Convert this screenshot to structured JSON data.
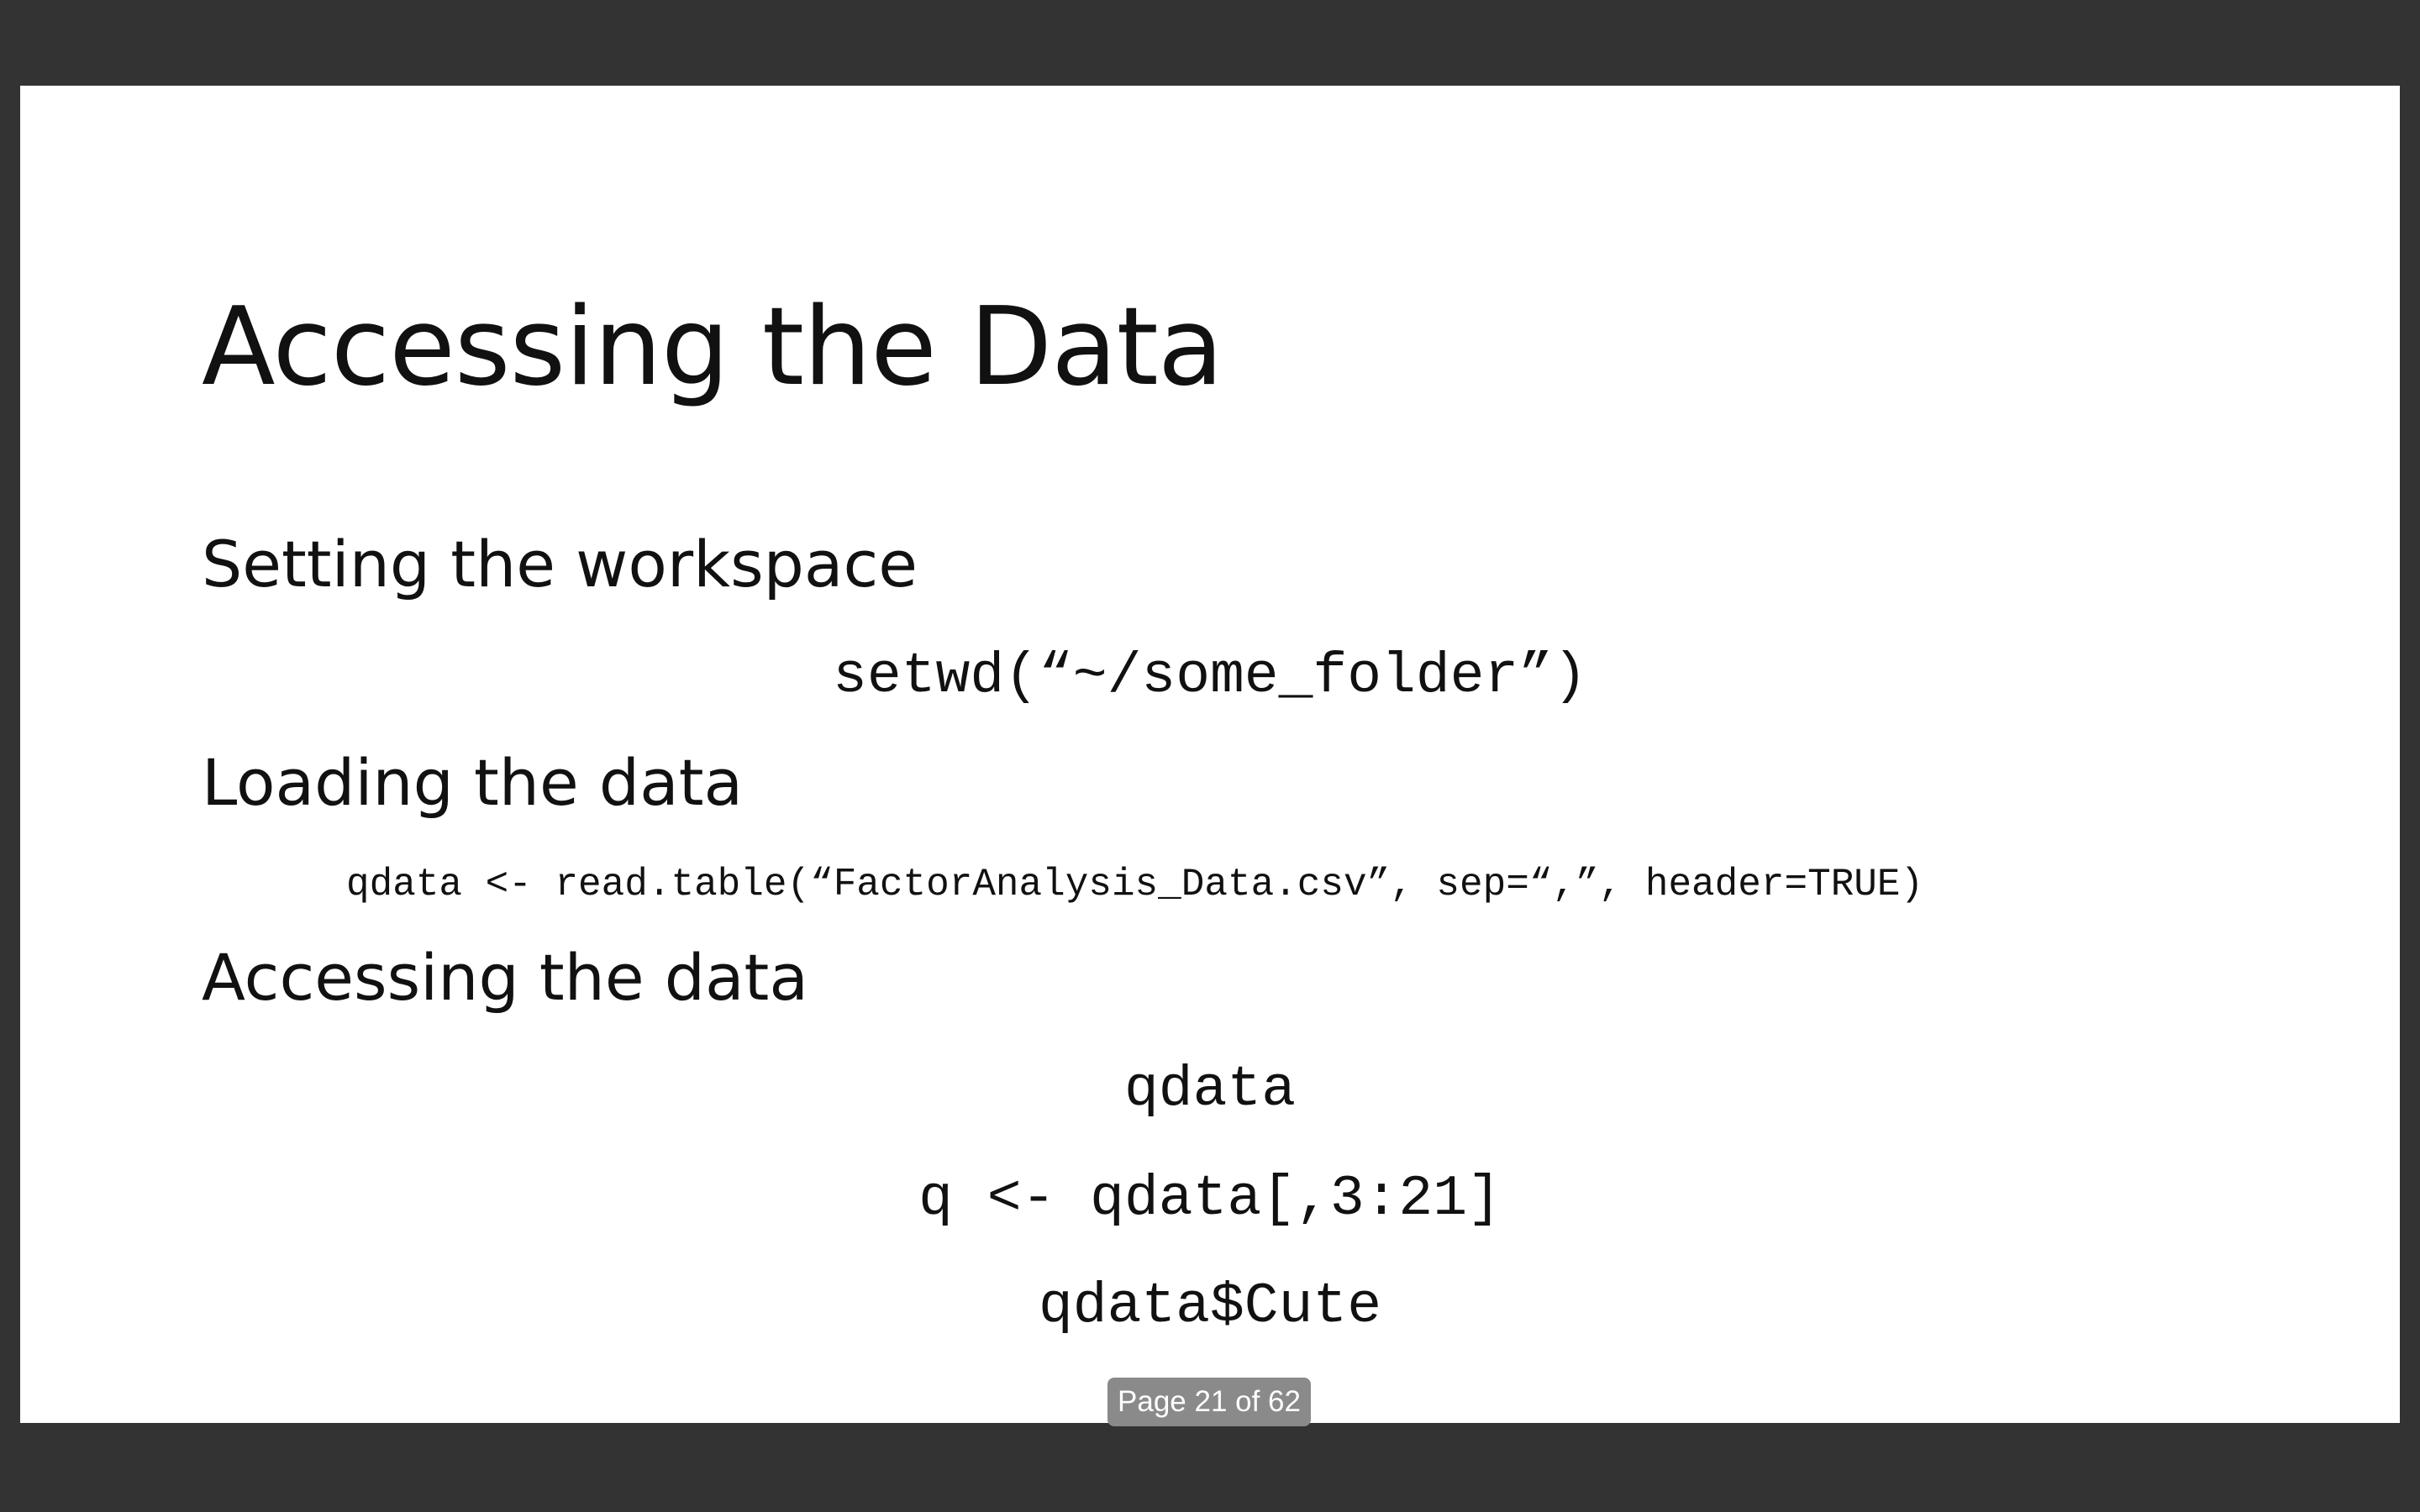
{
  "slide": {
    "title": "Accessing the Data",
    "sections": [
      {
        "heading": "Setting the workspace",
        "code": [
          "setwd(“~/some_folder”)"
        ]
      },
      {
        "heading": "Loading the data",
        "code": [
          "qdata <- read.table(“FactorAnalysis_Data.csv”, sep=“,”, header=TRUE)"
        ]
      },
      {
        "heading": "Accessing the data",
        "code": [
          "qdata",
          "q <- qdata[,3:21]",
          "qdata$Cute"
        ]
      }
    ]
  },
  "viewer": {
    "page_indicator": "Page 21 of 62"
  }
}
